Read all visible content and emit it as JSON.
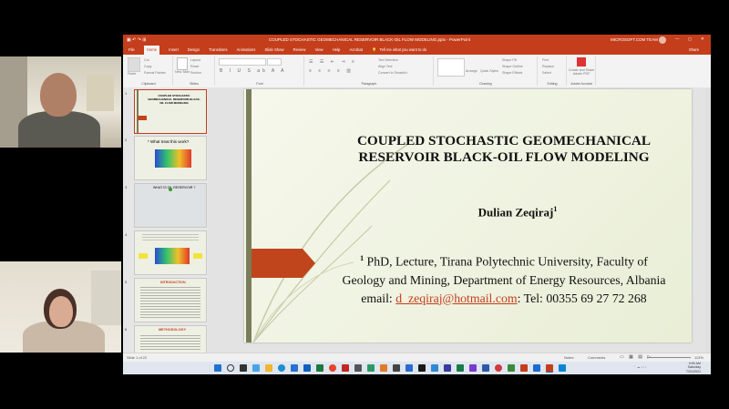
{
  "window": {
    "title": "COUPLED STOCHASTIC GEOMECHANICAL RESERVOIR BLACK-OIL FLOW MODELING.pptx - PowerPoint",
    "account": "MICROSOFT.COM TEAM",
    "share_label": "Share"
  },
  "menu": {
    "items": [
      "File",
      "Home",
      "Insert",
      "Design",
      "Transitions",
      "Animations",
      "Slide Show",
      "Review",
      "View",
      "Help",
      "Acrobat"
    ],
    "search_placeholder": "Tell me what you want to do"
  },
  "ribbon": {
    "clipboard": {
      "label": "Clipboard",
      "paste": "Paste",
      "cut": "Cut",
      "copy": "Copy",
      "format_painter": "Format Painter"
    },
    "slides": {
      "label": "Slides",
      "new_slide": "New Slide",
      "layout": "Layout",
      "reset": "Reset",
      "section": "Section"
    },
    "font": {
      "label": "Font"
    },
    "paragraph": {
      "label": "Paragraph",
      "text_direction": "Text Direction",
      "align_text": "Align Text",
      "convert_smartart": "Convert to SmartArt"
    },
    "drawing": {
      "label": "Drawing",
      "arrange": "Arrange",
      "quick_styles": "Quick Styles",
      "shape_fill": "Shape Fill",
      "shape_outline": "Shape Outline",
      "shape_effects": "Shape Effects"
    },
    "editing": {
      "label": "Editing",
      "find": "Find",
      "replace": "Replace",
      "select": "Select"
    },
    "acrobat": {
      "label": "Adobe Acrobat",
      "create_share": "Create and Share Adobe PDF"
    }
  },
  "thumbnails": [
    {
      "num": "1",
      "text": "COUPLED STOCHASTIC GEOMECHANICAL RESERVOIR BLACK-OIL FLOW MODELING"
    },
    {
      "num": "2",
      "text": "* What treat this work?"
    },
    {
      "num": "3",
      "text": "WHAT IS OIL RESERVOIR ?"
    },
    {
      "num": "4",
      "text": ""
    },
    {
      "num": "5",
      "text": "INTRODUCTION"
    },
    {
      "num": "6",
      "text": "METHODOLOGY"
    }
  ],
  "slide": {
    "title_line1": "COUPLED STOCHASTIC GEOMECHANICAL",
    "title_line2": "RESERVOIR BLACK-OIL FLOW MODELING",
    "author": "Dulian Zeqiraj",
    "author_sup": "1",
    "affil_sup": "1",
    "affil_line1": " PhD, Lecture, Tirana Polytechnic University, Faculty of",
    "affil_line2": "Geology and Mining, Department of Energy Resources, Albania",
    "email_prefix": "email: ",
    "email": "d_zeqiraj@hotmail.com",
    "tel": ": Tel: 00355 69 27 72 268"
  },
  "status": {
    "slide_info": "Slide 1 of 22",
    "notes": "Notes",
    "comments": "Comments",
    "zoom": "113%"
  },
  "taskbar": {
    "time": "9:50 AM",
    "day": "Saturday",
    "date": "7/31/2021"
  },
  "colors": {
    "ppt_accent": "#c43e1c",
    "slide_bar": "#7a7d5a",
    "arrow": "#c0451c"
  }
}
